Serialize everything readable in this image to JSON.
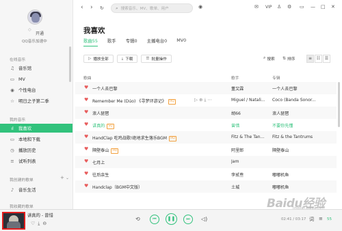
{
  "sidebar": {
    "user_status": "开通",
    "user_level": "QQ音乐加速中",
    "sections": [
      "在线音乐",
      "我的音乐",
      "我创建的歌单",
      "我收藏的歌单"
    ],
    "online_items": [
      {
        "label": "音乐馆",
        "icon": "music-hall-icon"
      },
      {
        "label": "MV",
        "icon": "mv-icon"
      },
      {
        "label": "个性电台",
        "icon": "radio-icon"
      },
      {
        "label": "明日之子第二季",
        "icon": "star-icon"
      }
    ],
    "my_items": [
      {
        "label": "我喜欢",
        "icon": "heart-icon",
        "active": true
      },
      {
        "label": "本地和下载",
        "icon": "download-icon"
      },
      {
        "label": "播放历史",
        "icon": "history-icon"
      },
      {
        "label": "试听列表",
        "icon": "list-icon"
      }
    ],
    "created_items": [
      {
        "label": "音乐生活",
        "icon": "music-note-icon"
      }
    ]
  },
  "topbar": {
    "search_placeholder": "搜索音乐、MV、歌单、用户",
    "vip": "VIP"
  },
  "page": {
    "title": "我喜欢",
    "tabs": [
      "歌曲55",
      "歌手",
      "专辑0",
      "主播电台0",
      "MV0"
    ],
    "active_tab": 0
  },
  "toolbar": {
    "play_all": "播放全部",
    "download": "下载",
    "batch": "批量操作",
    "search": "搜索",
    "sort": "排序"
  },
  "table": {
    "headers": {
      "title": "歌曲",
      "artist": "歌手",
      "album": "专辑"
    },
    "rows": [
      {
        "title": "一个人去巴黎",
        "badge": "",
        "artist": "董又霖",
        "album": "一个人去巴黎",
        "playing": false
      },
      {
        "title": "Remember Me (Dúo) 《寻梦环游记》",
        "badge": "",
        "artist": "Miguel / Natali...",
        "album": "Coco (Banda Sonor...",
        "playing": false
      },
      {
        "title": "浪人琵琶",
        "badge": "",
        "artist": "胡66",
        "album": "浪人琵琶",
        "playing": false
      },
      {
        "title": "讲真的",
        "badge": "",
        "artist": "曾惜",
        "album": "不要你先懂",
        "playing": true
      },
      {
        "title": "HandClap 吃鸡战歌!绝地求生落乐BGM",
        "badge": "",
        "artist": "Fitz & The Tan...",
        "album": "Fitz & the Tantrums",
        "playing": false
      },
      {
        "title": "隔壁泰山",
        "badge": "",
        "artist": "阿里郎",
        "album": "隔壁泰山",
        "playing": false
      },
      {
        "title": "七月上",
        "badge": "",
        "artist": "Jam",
        "album": "",
        "playing": false
      },
      {
        "title": "往后余生",
        "badge": "",
        "artist": "李贰叁",
        "album": "嘟嘟机鱼",
        "playing": false
      },
      {
        "title": "Handclap（BGM中文版）",
        "badge": "",
        "artist": "土城",
        "album": "嘟嘟机鱼",
        "playing": false
      }
    ]
  },
  "player": {
    "now_playing": "讲真的 - 曾惜",
    "time": "02:41 / 03:17",
    "count": "55"
  },
  "watermark": {
    "text": "Baidu经验",
    "sub": "jingyan.baidu.com"
  }
}
